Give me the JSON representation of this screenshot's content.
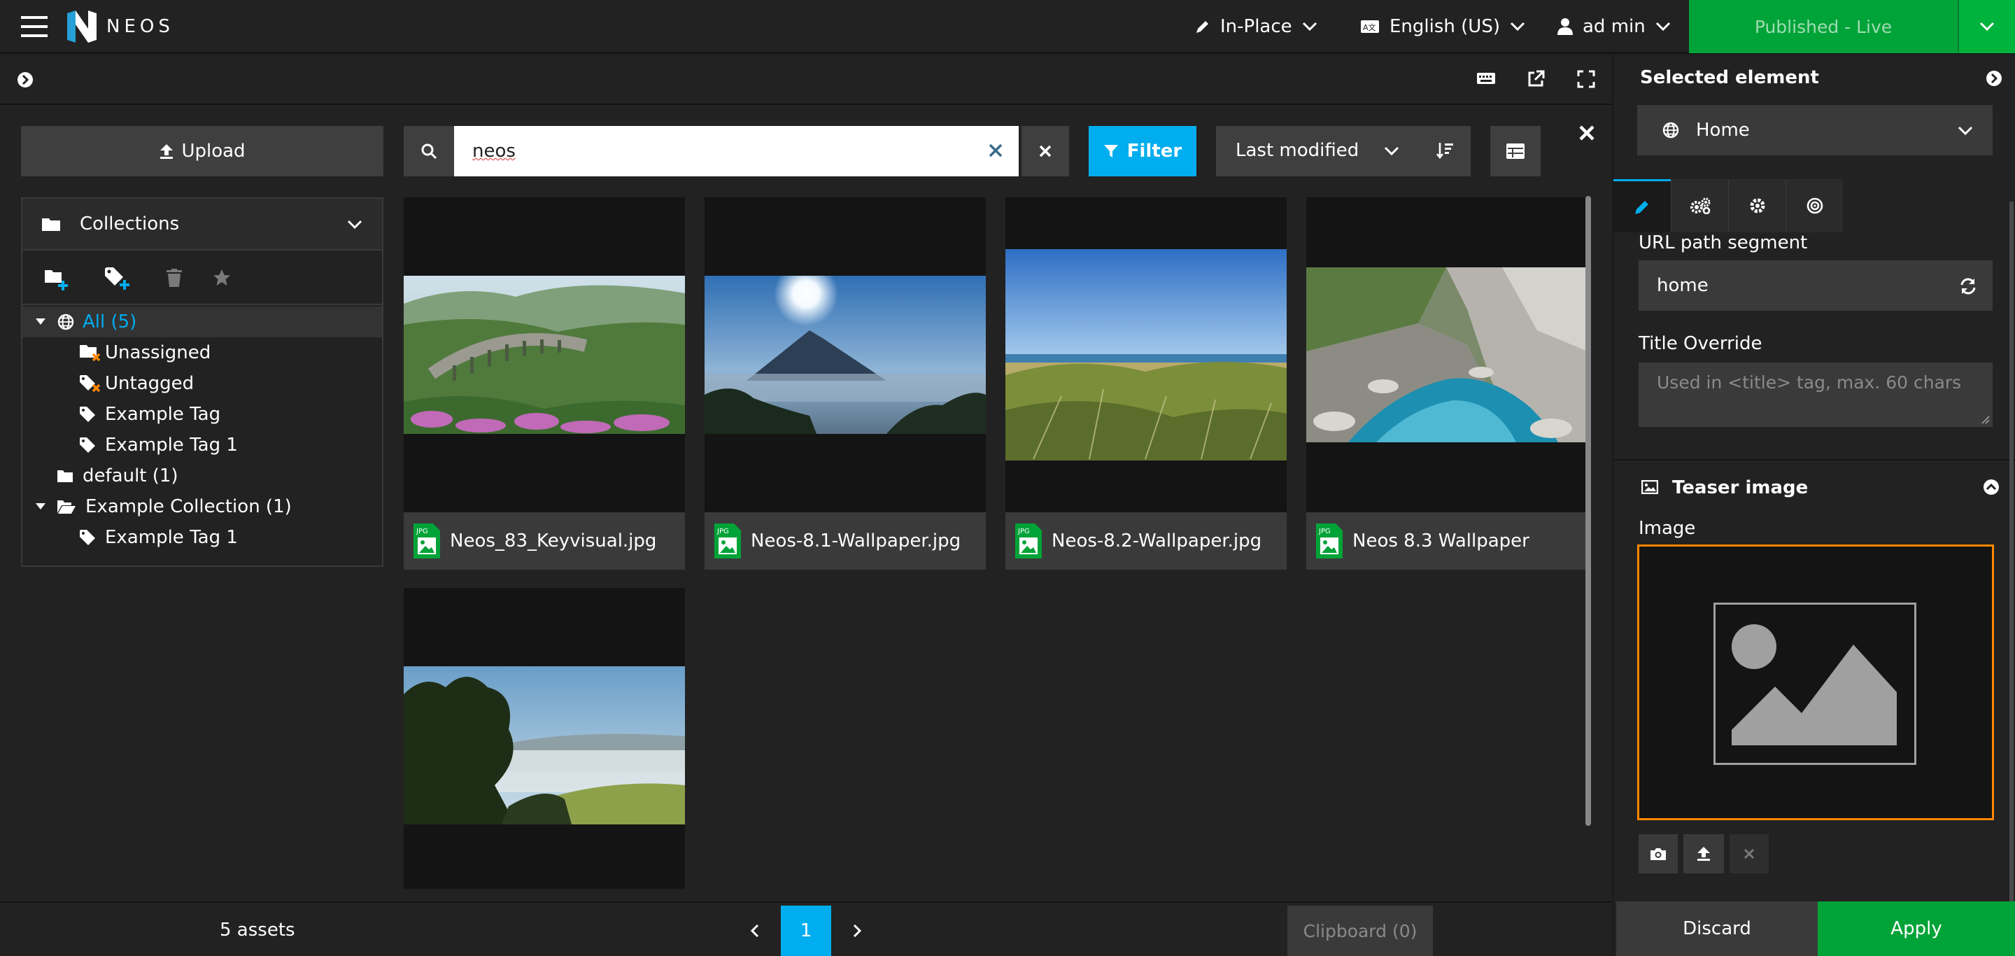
{
  "topbar": {
    "brand": "NEOS",
    "edit_mode": "In-Place",
    "language": "English (US)",
    "user": "ad min",
    "publish_label": "Published - Live"
  },
  "media": {
    "upload_label": "Upload",
    "search_value": "neos",
    "filter_label": "Filter",
    "sort_label": "Last modified",
    "collections_title": "Collections",
    "tree": [
      {
        "label": "All (5)"
      },
      {
        "label": "Unassigned"
      },
      {
        "label": "Untagged"
      },
      {
        "label": "Example Tag"
      },
      {
        "label": "Example Tag 1"
      },
      {
        "label": "default (1)"
      },
      {
        "label": "Example Collection (1)"
      },
      {
        "label": "Example Tag 1"
      }
    ],
    "assets": [
      {
        "name": "Neos_83_Keyvisual.jpg",
        "file_type": "JPG"
      },
      {
        "name": "Neos-8.1-Wallpaper.jpg",
        "file_type": "JPG"
      },
      {
        "name": "Neos-8.2-Wallpaper.jpg",
        "file_type": "JPG"
      },
      {
        "name": "Neos 8.3 Wallpaper",
        "file_type": "JPG"
      }
    ],
    "asset_count": "5 assets",
    "current_page": "1",
    "clipboard_label": "Clipboard (0)"
  },
  "inspector": {
    "title": "Selected element",
    "node": "Home",
    "url_label": "URL path segment",
    "url_value": "home",
    "title_override_label": "Title Override",
    "title_override_placeholder": "Used in <title> tag, max. 60 chars",
    "teaser_section": "Teaser image",
    "image_label": "Image",
    "discard_label": "Discard",
    "apply_label": "Apply"
  },
  "colors": {
    "accent_blue": "#00adee",
    "publish_green": "#00a338",
    "apply_green": "#00a338",
    "selected_border": "#ff8700"
  }
}
